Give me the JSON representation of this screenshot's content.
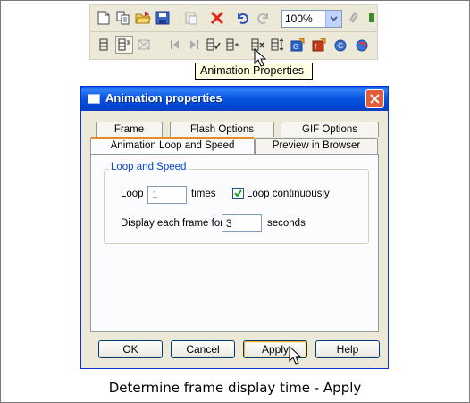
{
  "toolbar": {
    "zoom_value": "100%",
    "tooltip": "Animation Properties",
    "row1_icons": [
      "new-document-icon",
      "copy-page-icon",
      "open-folder-icon",
      "save-icon",
      "paste-icon",
      "delete-icon",
      "undo-icon",
      "redo-icon"
    ],
    "row2_icons": [
      "frame-list-icon",
      "frame-props-icon",
      "film-strip-icon",
      "previous-frame-icon",
      "next-frame-icon",
      "frame-check-icon",
      "frame-add-icon",
      "animation-properties-icon",
      "frame-order-icon",
      "export-gif-icon",
      "export-flash-icon",
      "browser-preview-icon",
      "refresh-icon"
    ]
  },
  "dialog": {
    "title": "Animation properties",
    "tabs_back": [
      "Frame",
      "Flash Options",
      "GIF Options"
    ],
    "tabs_front": [
      "Animation Loop and Speed",
      "Preview in Browser"
    ],
    "group_label": "Loop and Speed",
    "loop_label": "Loop",
    "loop_value": "1",
    "times_label": "times",
    "loop_continuously_label": "Loop continuously",
    "loop_continuously_checked": true,
    "display_label": "Display each frame for:",
    "display_value": "3",
    "seconds_label": "seconds",
    "buttons": {
      "ok": "OK",
      "cancel": "Cancel",
      "apply": "Apply",
      "help": "Help"
    }
  },
  "caption": "Determine frame display time - Apply",
  "colors": {
    "title_bar": "#0a57e0",
    "close_button": "#e45b3a",
    "tab_highlight": "#e68b2c",
    "group_label": "#0046d5"
  }
}
